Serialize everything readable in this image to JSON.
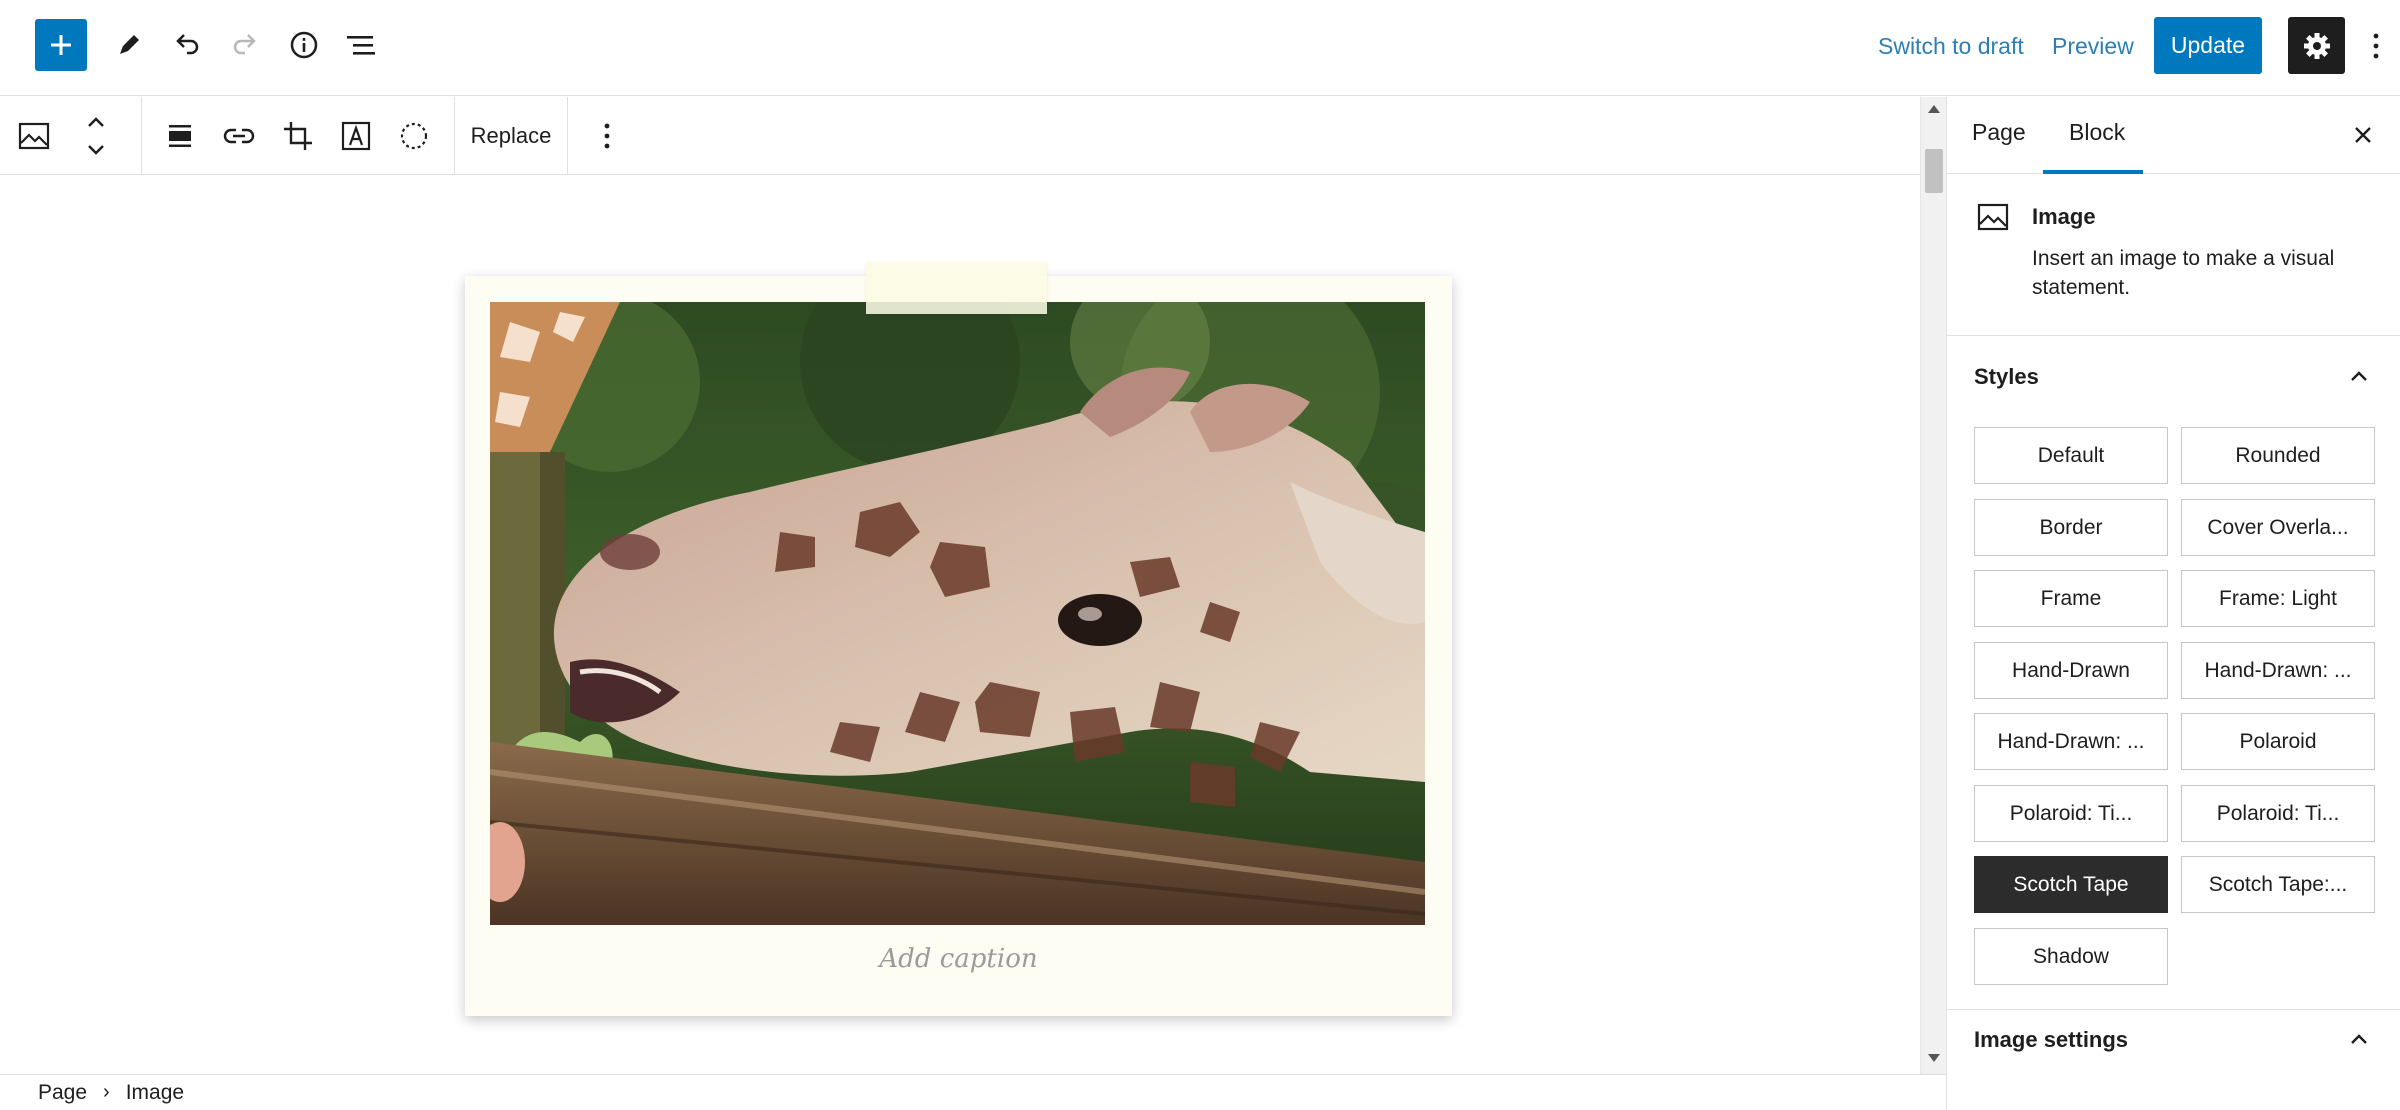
{
  "header": {
    "switch_to_draft": "Switch to draft",
    "preview": "Preview",
    "update": "Update"
  },
  "block_toolbar": {
    "replace": "Replace"
  },
  "canvas": {
    "caption_placeholder": "Add caption"
  },
  "breadcrumb": [
    "Page",
    "Image"
  ],
  "sidebar": {
    "tabs": [
      "Page",
      "Block"
    ],
    "active_tab": "Block",
    "block": {
      "title": "Image",
      "description": "Insert an image to make a visual statement."
    },
    "styles": {
      "title": "Styles",
      "options": [
        "Default",
        "Rounded",
        "Border",
        "Cover Overla...",
        "Frame",
        "Frame: Light",
        "Hand-Drawn",
        "Hand-Drawn: ...",
        "Hand-Drawn: ...",
        "Polaroid",
        "Polaroid: Ti...",
        "Polaroid: Ti...",
        "Scotch Tape",
        "Scotch Tape:...",
        "Shadow"
      ],
      "active": "Scotch Tape"
    },
    "image_settings": {
      "title": "Image settings"
    }
  },
  "colors": {
    "accent": "#0078bd",
    "dark": "#1e1e1e",
    "link": "#2b7fb5"
  }
}
